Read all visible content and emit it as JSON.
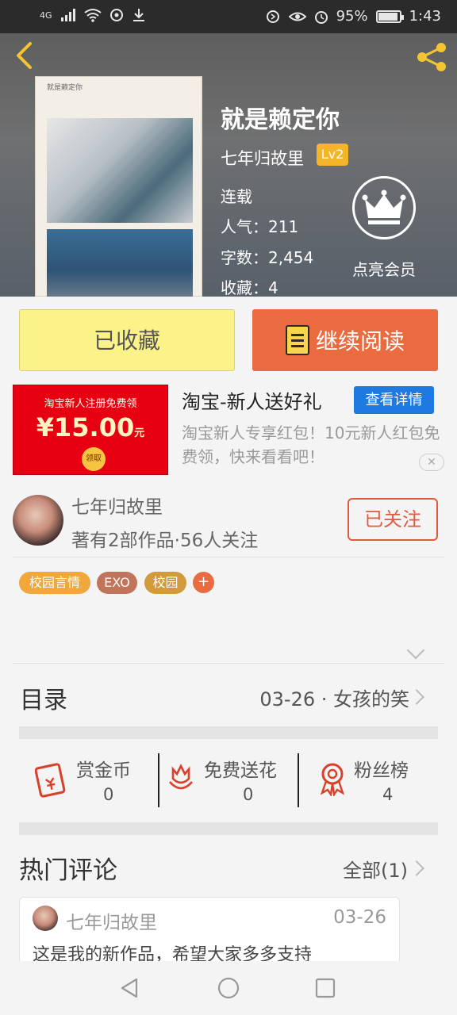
{
  "status_bar": {
    "network": "4G",
    "battery": "95%",
    "battery_level": 0.95,
    "time": "1:43"
  },
  "book": {
    "title": "就是赖定你",
    "cover_text": "就是赖定你",
    "author": "七年归故里",
    "level": "Lv2",
    "status": "连载",
    "popularity": "人气：211",
    "word_count": "字数：2,454",
    "favorites": "收藏：4"
  },
  "vip": {
    "label": "点亮会员"
  },
  "actions": {
    "favorited_label": "已收藏",
    "read_label": "继续阅读"
  },
  "ad": {
    "image_headline": "淘宝新人注册免费领",
    "image_amount": "¥15.00",
    "image_unit": "元",
    "image_button": "领取",
    "title": "淘宝-新人送好礼",
    "detail_button": "查看详情",
    "description": "淘宝新人专享红包！10元新人红包免费领，快来看看吧！",
    "close": "✕"
  },
  "author_card": {
    "name": "七年归故里",
    "summary": "著有2部作品·56人关注",
    "follow_label": "已关注"
  },
  "tags": [
    {
      "label": "校园言情",
      "color": "#f0a83c"
    },
    {
      "label": "EXO",
      "color": "#c0745a"
    },
    {
      "label": "校园",
      "color": "#d29a3a"
    }
  ],
  "tag_add": "+",
  "toc": {
    "label": "目录",
    "latest": "03-26 · 女孩的笑"
  },
  "gifts": [
    {
      "label": "赏金币",
      "count": "0"
    },
    {
      "label": "免费送花",
      "count": "0"
    },
    {
      "label": "粉丝榜",
      "count": "4"
    }
  ],
  "comments": {
    "header": "热门评论",
    "all_label": "全部(1)",
    "items": [
      {
        "author": "七年归故里",
        "date": "03-26",
        "text": "这是我的新作品，希望大家多多支持"
      }
    ]
  },
  "colors": {
    "accent": "#ea6b3f",
    "fav_button": "#fbf38a",
    "ad_blue": "#1e7ae0",
    "icon_red": "#d8402a"
  }
}
